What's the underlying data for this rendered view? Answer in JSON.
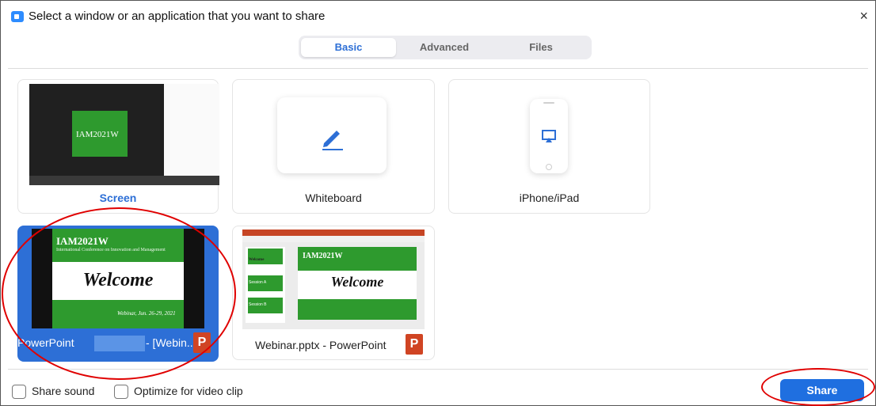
{
  "window": {
    "title": "Select a window or an application that you want to share",
    "close_glyph": "×"
  },
  "tabs": [
    {
      "label": "Basic",
      "active": true
    },
    {
      "label": "Advanced",
      "active": false
    },
    {
      "label": "Files",
      "active": false
    }
  ],
  "sources": {
    "screen": {
      "label": "Screen",
      "thumb_text": "IAM2021W"
    },
    "whiteboard": {
      "label": "Whiteboard",
      "icon": "pen-icon"
    },
    "iphone": {
      "label": "iPhone/iPad",
      "icon": "airplay-icon"
    },
    "ppt_window": {
      "label_a": "PowerPoint",
      "label_b": "- [Webin...",
      "slide_title": "IAM2021W",
      "slide_subtitle": "International Conference on Innovation and Management",
      "slide_heading": "Welcome",
      "slide_footer": "Webinar, Jun. 26-29, 2021"
    },
    "pptx_file": {
      "label": "Webinar.pptx - PowerPoint",
      "slide_title": "IAM2021W",
      "slide_heading": "Welcome",
      "sidebar_items": [
        "Welcome",
        "Session A",
        "Session B"
      ]
    }
  },
  "footer": {
    "share_sound": "Share sound",
    "optimize_video": "Optimize for video clip",
    "share_button": "Share"
  },
  "colors": {
    "accent": "#2d6fd6",
    "annotation": "#e00000",
    "powerpoint": "#d04423",
    "slide_green": "#2e9a2e"
  }
}
